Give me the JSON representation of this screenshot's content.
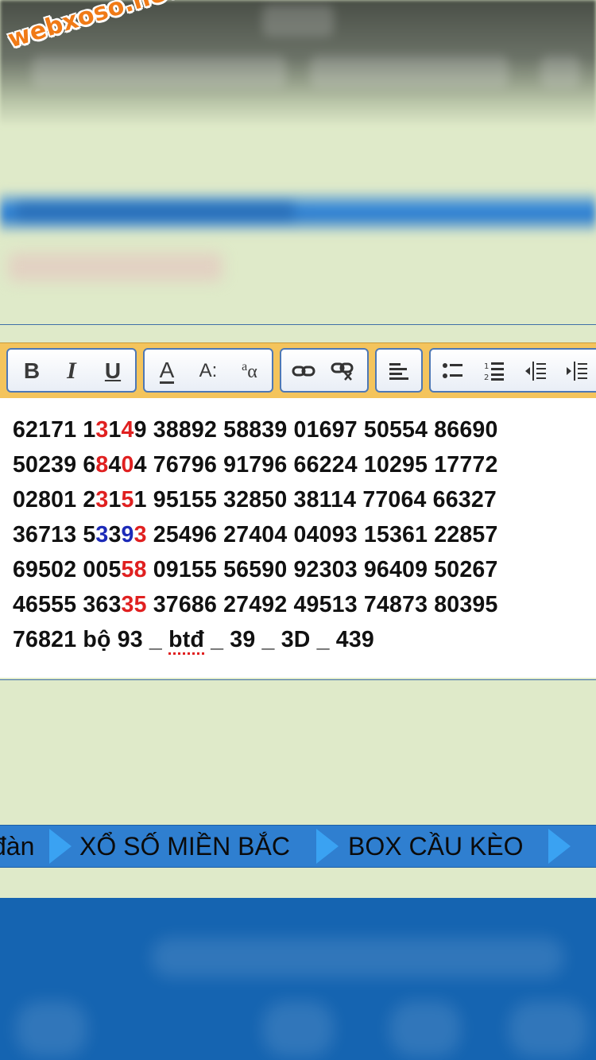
{
  "watermark": "webxoso.net",
  "toolbar": {
    "groups": [
      {
        "buttons": [
          {
            "icon": "bold-icon",
            "label": "B"
          },
          {
            "icon": "italic-icon",
            "label": "I"
          },
          {
            "icon": "underline-icon",
            "label": "U"
          }
        ]
      },
      {
        "buttons": [
          {
            "icon": "font-color-icon",
            "label": "A"
          },
          {
            "icon": "font-size-icon",
            "label": "A:"
          },
          {
            "icon": "font-family-icon",
            "label": "a"
          }
        ]
      },
      {
        "buttons": [
          {
            "icon": "link-icon"
          },
          {
            "icon": "unlink-icon"
          }
        ]
      },
      {
        "buttons": [
          {
            "icon": "align-left-icon"
          }
        ]
      },
      {
        "buttons": [
          {
            "icon": "bulleted-list-icon"
          },
          {
            "icon": "numbered-list-icon"
          },
          {
            "icon": "outdent-icon"
          },
          {
            "icon": "indent-icon"
          }
        ]
      }
    ]
  },
  "content_lines": [
    [
      {
        "t": "62171 1"
      },
      {
        "t": "3",
        "c": "red"
      },
      {
        "t": "1"
      },
      {
        "t": "4",
        "c": "red"
      },
      {
        "t": "9 38892 58839 01697 50554 86690"
      }
    ],
    [
      {
        "t": "50239 6"
      },
      {
        "t": "8",
        "c": "red"
      },
      {
        "t": "4"
      },
      {
        "t": "0",
        "c": "red"
      },
      {
        "t": "4 76796 91796 66224 10295 17772"
      }
    ],
    [
      {
        "t": "02801 2"
      },
      {
        "t": "3",
        "c": "red"
      },
      {
        "t": "1"
      },
      {
        "t": "5",
        "c": "red"
      },
      {
        "t": "1 95155 32850 38114 77064 66327"
      }
    ],
    [
      {
        "t": "36713 5"
      },
      {
        "t": "3",
        "c": "blue"
      },
      {
        "t": "3"
      },
      {
        "t": "9",
        "c": "blue"
      },
      {
        "t": "3",
        "c": "red"
      },
      {
        "t": " 25496 27404 04093 15361 22857"
      }
    ],
    [
      {
        "t": "69502 005"
      },
      {
        "t": "58",
        "c": "red"
      },
      {
        "t": " 09155 56590 92303 96409 50267"
      }
    ],
    [
      {
        "t": "46555 363"
      },
      {
        "t": "35",
        "c": "red"
      },
      {
        "t": " 37686 27492 49513 74873 80395"
      }
    ],
    [
      {
        "t": "76821 bộ 93 _ "
      },
      {
        "t": "btđ",
        "c": "spell"
      },
      {
        "t": " _ 39 _ 3D _ 439"
      }
    ]
  ],
  "nav": {
    "items": [
      "đàn",
      "XỔ SỐ MIỀN BẮC",
      "BOX CẦU KÈO"
    ]
  },
  "colors": {
    "page_bg": "#dfeac9",
    "toolbar_bg": "#f4c45c",
    "nav_bg": "#2f7fd0",
    "highlight_red": "#e02020",
    "highlight_blue": "#1c2ab8"
  }
}
